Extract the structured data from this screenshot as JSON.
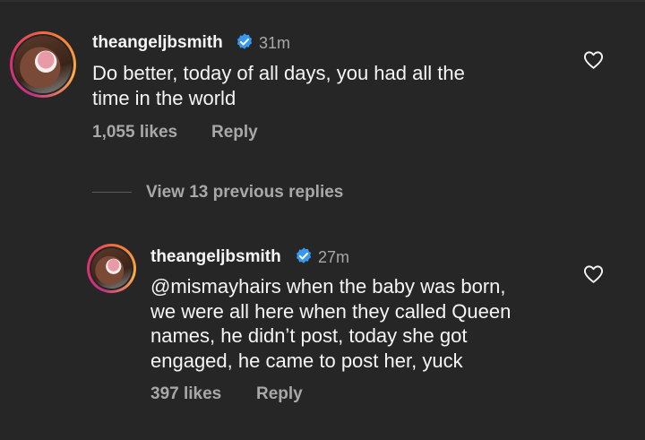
{
  "comments": [
    {
      "username": "theangeljbsmith",
      "time": "31m",
      "text_lines": [
        "Do better, today of all days, you had all the",
        "time in the world"
      ],
      "likes": "1,055 likes",
      "reply_label": "Reply"
    },
    {
      "username": "theangeljbsmith",
      "time": "27m",
      "text_lines": [
        "@mismayhairs when the baby was born,",
        "we were all here when they called Queen",
        "names, he didn’t post, today she got",
        "engaged, he came to post her, yuck"
      ],
      "likes": "397 likes",
      "reply_label": "Reply"
    }
  ],
  "thread": {
    "view_replies_label": "View 13 previous replies"
  },
  "colors": {
    "background": "#262626",
    "verified": "#3897f0",
    "secondary_text": "#a8a8a8"
  },
  "icons": {
    "verified": "verified-badge-icon",
    "like": "heart-outline-icon"
  }
}
